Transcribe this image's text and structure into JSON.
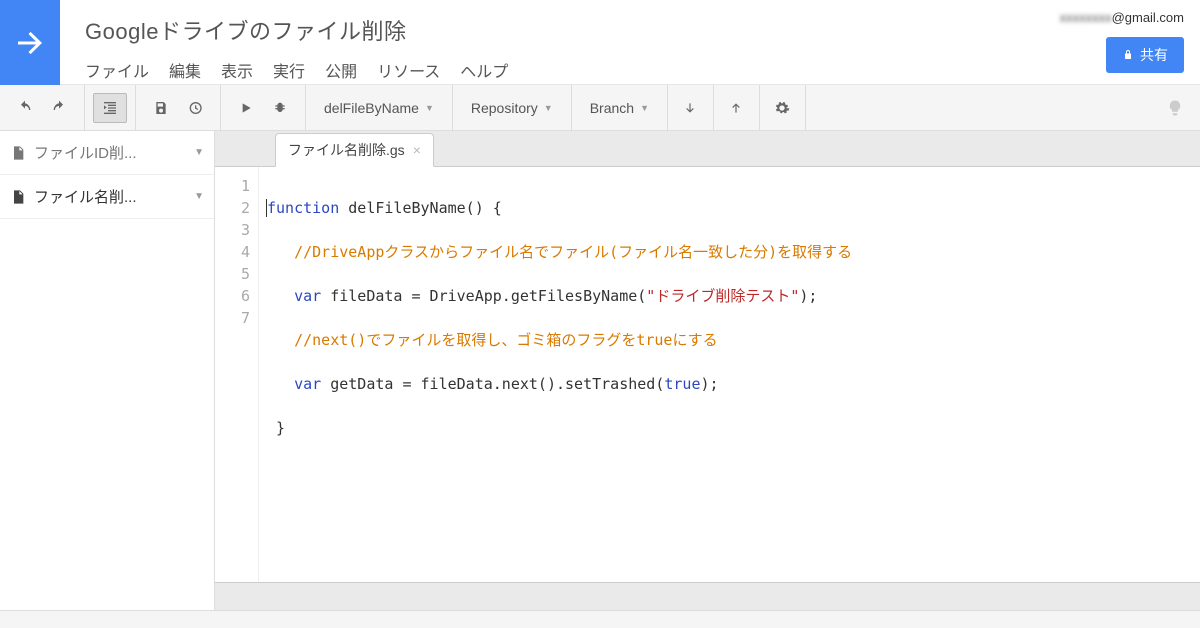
{
  "header": {
    "project_title": "Googleドライブのファイル削除",
    "email_redacted": "xxxxxxxx",
    "email_suffix": "@gmail.com",
    "share_label": "共有"
  },
  "menu": {
    "file": "ファイル",
    "edit": "編集",
    "view": "表示",
    "run": "実行",
    "publish": "公開",
    "resources": "リソース",
    "help": "ヘルプ"
  },
  "toolbar": {
    "function_selector": "delFileByName",
    "repository": "Repository",
    "branch": "Branch"
  },
  "sidebar": {
    "items": [
      {
        "label": "ファイルID削...",
        "active": false
      },
      {
        "label": "ファイル名削...",
        "active": true
      }
    ]
  },
  "tab": {
    "label": "ファイル名削除.gs"
  },
  "code": {
    "lines": [
      "1",
      "2",
      "3",
      "4",
      "5",
      "6",
      "7"
    ],
    "l1_kw": "function",
    "l1_name": " delFileByName() {",
    "l2_indent": "   ",
    "l2_cm": "//DriveAppクラスからファイル名でファイル(ファイル名一致した分)を取得する",
    "l3_indent": "   ",
    "l3_kw": "var",
    "l3_a": " fileData = DriveApp.getFilesByName(",
    "l3_str": "\"ドライブ削除テスト\"",
    "l3_b": ");",
    "l4_indent": "   ",
    "l4_cm": "//next()でファイルを取得し、ゴミ箱のフラグをtrueにする",
    "l5_indent": "   ",
    "l5_kw": "var",
    "l5_a": " getData = fileData.next().setTrashed(",
    "l5_lit": "true",
    "l5_b": ");",
    "l6": " }",
    "l7": ""
  }
}
